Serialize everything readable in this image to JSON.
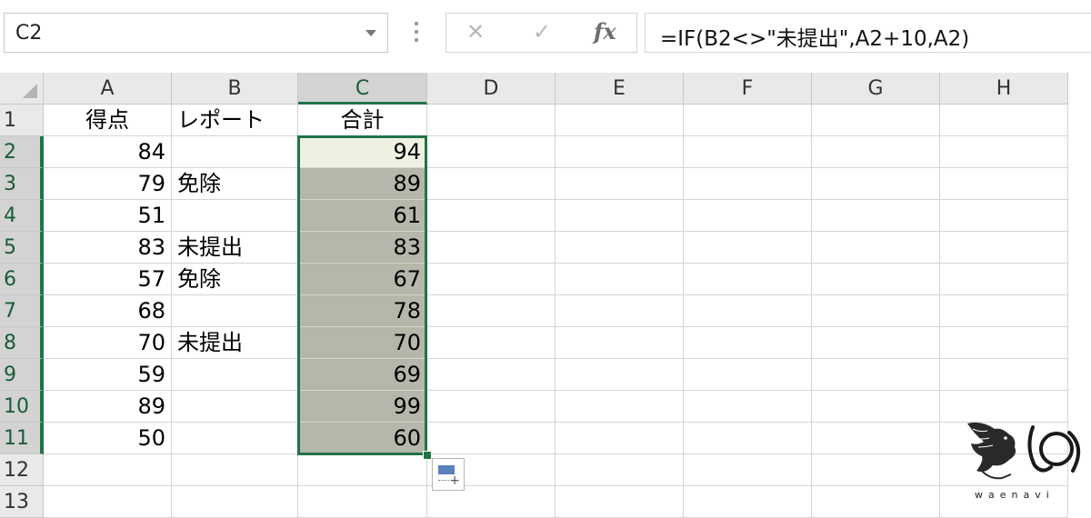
{
  "formula_bar": {
    "name_box": "C2",
    "cancel_symbol": "✕",
    "enter_symbol": "✓",
    "fx_label": "fx",
    "formula": "=IF(B2<>\"未提出\",A2+10,A2)"
  },
  "sheet": {
    "columns": [
      "A",
      "B",
      "C",
      "D",
      "E",
      "F",
      "G",
      "H"
    ],
    "selected_column": "C",
    "rows": [
      {
        "num": "1",
        "a": "得点",
        "b": "レポート",
        "c": "合計"
      },
      {
        "num": "2",
        "a": "84",
        "b": "",
        "c": "94"
      },
      {
        "num": "3",
        "a": "79",
        "b": "免除",
        "c": "89"
      },
      {
        "num": "4",
        "a": "51",
        "b": "",
        "c": "61"
      },
      {
        "num": "5",
        "a": "83",
        "b": "未提出",
        "c": "83"
      },
      {
        "num": "6",
        "a": "57",
        "b": "免除",
        "c": "67"
      },
      {
        "num": "7",
        "a": "68",
        "b": "",
        "c": "78"
      },
      {
        "num": "8",
        "a": "70",
        "b": "未提出",
        "c": "70"
      },
      {
        "num": "9",
        "a": "59",
        "b": "",
        "c": "69"
      },
      {
        "num": "10",
        "a": "89",
        "b": "",
        "c": "99"
      },
      {
        "num": "11",
        "a": "50",
        "b": "",
        "c": "60"
      },
      {
        "num": "12",
        "a": "",
        "b": "",
        "c": ""
      },
      {
        "num": "13",
        "a": "",
        "b": "",
        "c": ""
      }
    ],
    "active_cell": "C2",
    "selected_range": "C2:C11"
  },
  "watermark": {
    "text": "waenavi"
  },
  "colors": {
    "accent_green": "#217346",
    "selection_fill": "#b4b7a9",
    "header_bg": "#e9e9e9"
  }
}
